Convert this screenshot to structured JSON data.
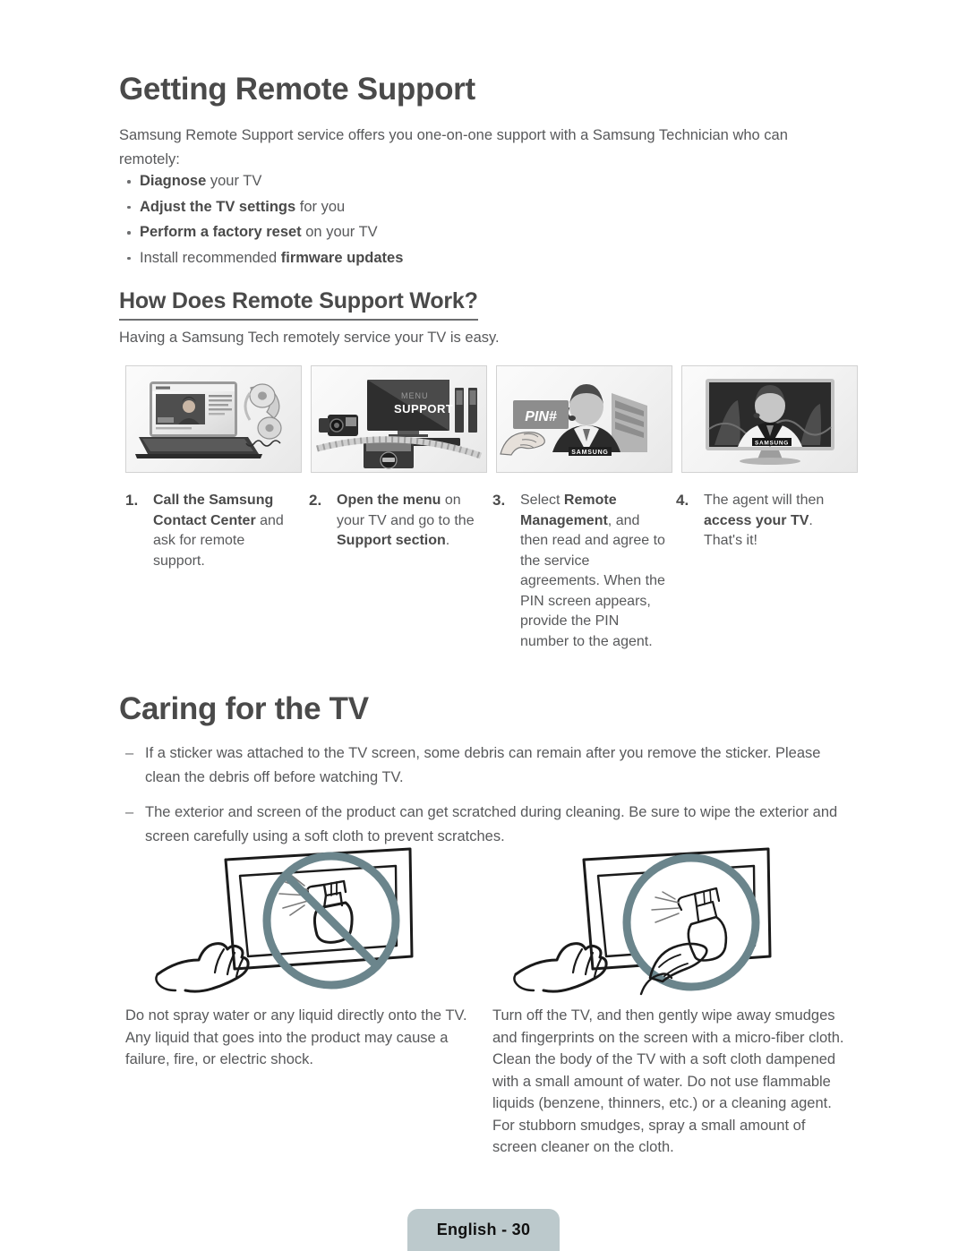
{
  "document": {
    "section1": {
      "heading": "Getting Remote Support",
      "intro": "Samsung Remote Support service offers you one-on-one support with a Samsung Technician who can remotely:",
      "bullets": [
        {
          "bold_lead": "Diagnose",
          "rest": " your TV"
        },
        {
          "bold_lead": "Adjust the TV settings",
          "rest": " for you"
        },
        {
          "bold_lead": "Perform a factory reset",
          "rest": " on your TV"
        },
        {
          "plain_lead": "Install recommended ",
          "bold_tail": "firmware updates"
        }
      ],
      "subheading": "How Does Remote Support Work?",
      "sub_intro": "Having a Samsung Tech remotely service your TV is easy.",
      "steps": [
        {
          "number": "1.",
          "bold_part": "Call the Samsung Contact Center",
          "rest": " and ask for remote support.",
          "image_name": "laptop-phone-illustration",
          "image_labels": []
        },
        {
          "number": "2.",
          "bold_part": "Open the menu",
          "mid": " on your TV and go to the ",
          "bold_part2": "Support section",
          "rest": ".",
          "image_name": "tv-menu-support-illustration",
          "image_labels": [
            "MENU",
            "SUPPORT"
          ]
        },
        {
          "number": "3.",
          "lead": "Select ",
          "bold_part": "Remote Management",
          "rest": ", and then read and agree to the service agreements. When the PIN screen appears, provide the PIN number to the agent.",
          "image_name": "pin-card-agent-illustration",
          "image_labels": [
            "PIN#",
            "SAMSUNG"
          ]
        },
        {
          "number": "4.",
          "lead": "The agent will then ",
          "bold_part": "access your TV",
          "rest": ". That's it!",
          "image_name": "tv-agent-illustration",
          "image_labels": [
            "SAMSUNG"
          ]
        }
      ]
    },
    "section2": {
      "heading": "Caring for the TV",
      "notes": [
        "If a sticker was attached to the TV screen, some debris can remain after you remove the sticker. Please clean the debris off before watching TV.",
        "The exterior and screen of the product can get scratched during cleaning. Be sure to wipe the exterior and screen carefully using a soft cloth to prevent scratches."
      ],
      "care_items": [
        {
          "image_name": "no-spray-on-tv-illustration",
          "caption": "Do not spray water or any liquid directly onto the TV. Any liquid that goes into the product may cause a failure, fire, or electric shock."
        },
        {
          "image_name": "spray-on-cloth-illustration",
          "caption": "Turn off the TV, and then gently wipe away smudges and fingerprints on the screen with a micro-fiber cloth. Clean the body of the TV with a soft cloth dampened with a small amount of water. Do not use flammable liquids (benzene, thinners, etc.) or a cleaning agent. For stubborn smudges, spray a small amount of screen cleaner on the cloth."
        }
      ]
    },
    "footer": {
      "page_label": "English - 30"
    },
    "colors": {
      "heading": "#4a4a4a",
      "body": "#58595b",
      "footer_badge": "#bcc9cc",
      "illustration_accent": "#6b858c"
    }
  }
}
